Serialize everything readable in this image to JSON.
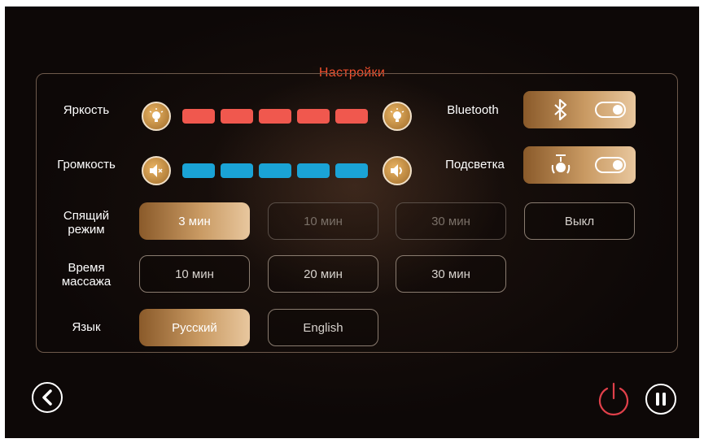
{
  "title": "Настройки",
  "labels": {
    "brightness": "Яркость",
    "volume": "Громкость",
    "sleep_line1": "Спящий",
    "sleep_line2": "режим",
    "massage_line1": "Время",
    "massage_line2": "массажа",
    "language": "Язык",
    "bluetooth": "Bluetooth",
    "backlight": "Подсветка"
  },
  "brightness": {
    "level": 5,
    "segments": 5,
    "color": "#f0584e"
  },
  "volume": {
    "level": 5,
    "segments": 5,
    "color": "#1aa3d6"
  },
  "sleep_options": [
    "3 мин",
    "10 мин",
    "30 мин",
    "Выкл"
  ],
  "sleep_selected": "3 мин",
  "massage_options": [
    "10 мин",
    "20 мин",
    "30 мин"
  ],
  "language_options": [
    "Русский",
    "English"
  ],
  "language_selected": "Русский",
  "toggles": {
    "bluetooth": "on",
    "backlight": "on"
  },
  "colors": {
    "accent": "#c99a63",
    "title": "#f04f2e",
    "power": "#e0404a"
  },
  "icons": {
    "back": "chevron-left-icon",
    "power": "power-icon",
    "pause": "pause-icon",
    "bluetooth": "bluetooth-icon",
    "backlight": "lamp-icon",
    "brightness": "bulb-icon",
    "mute": "speaker-mute-icon",
    "sound": "speaker-icon"
  }
}
